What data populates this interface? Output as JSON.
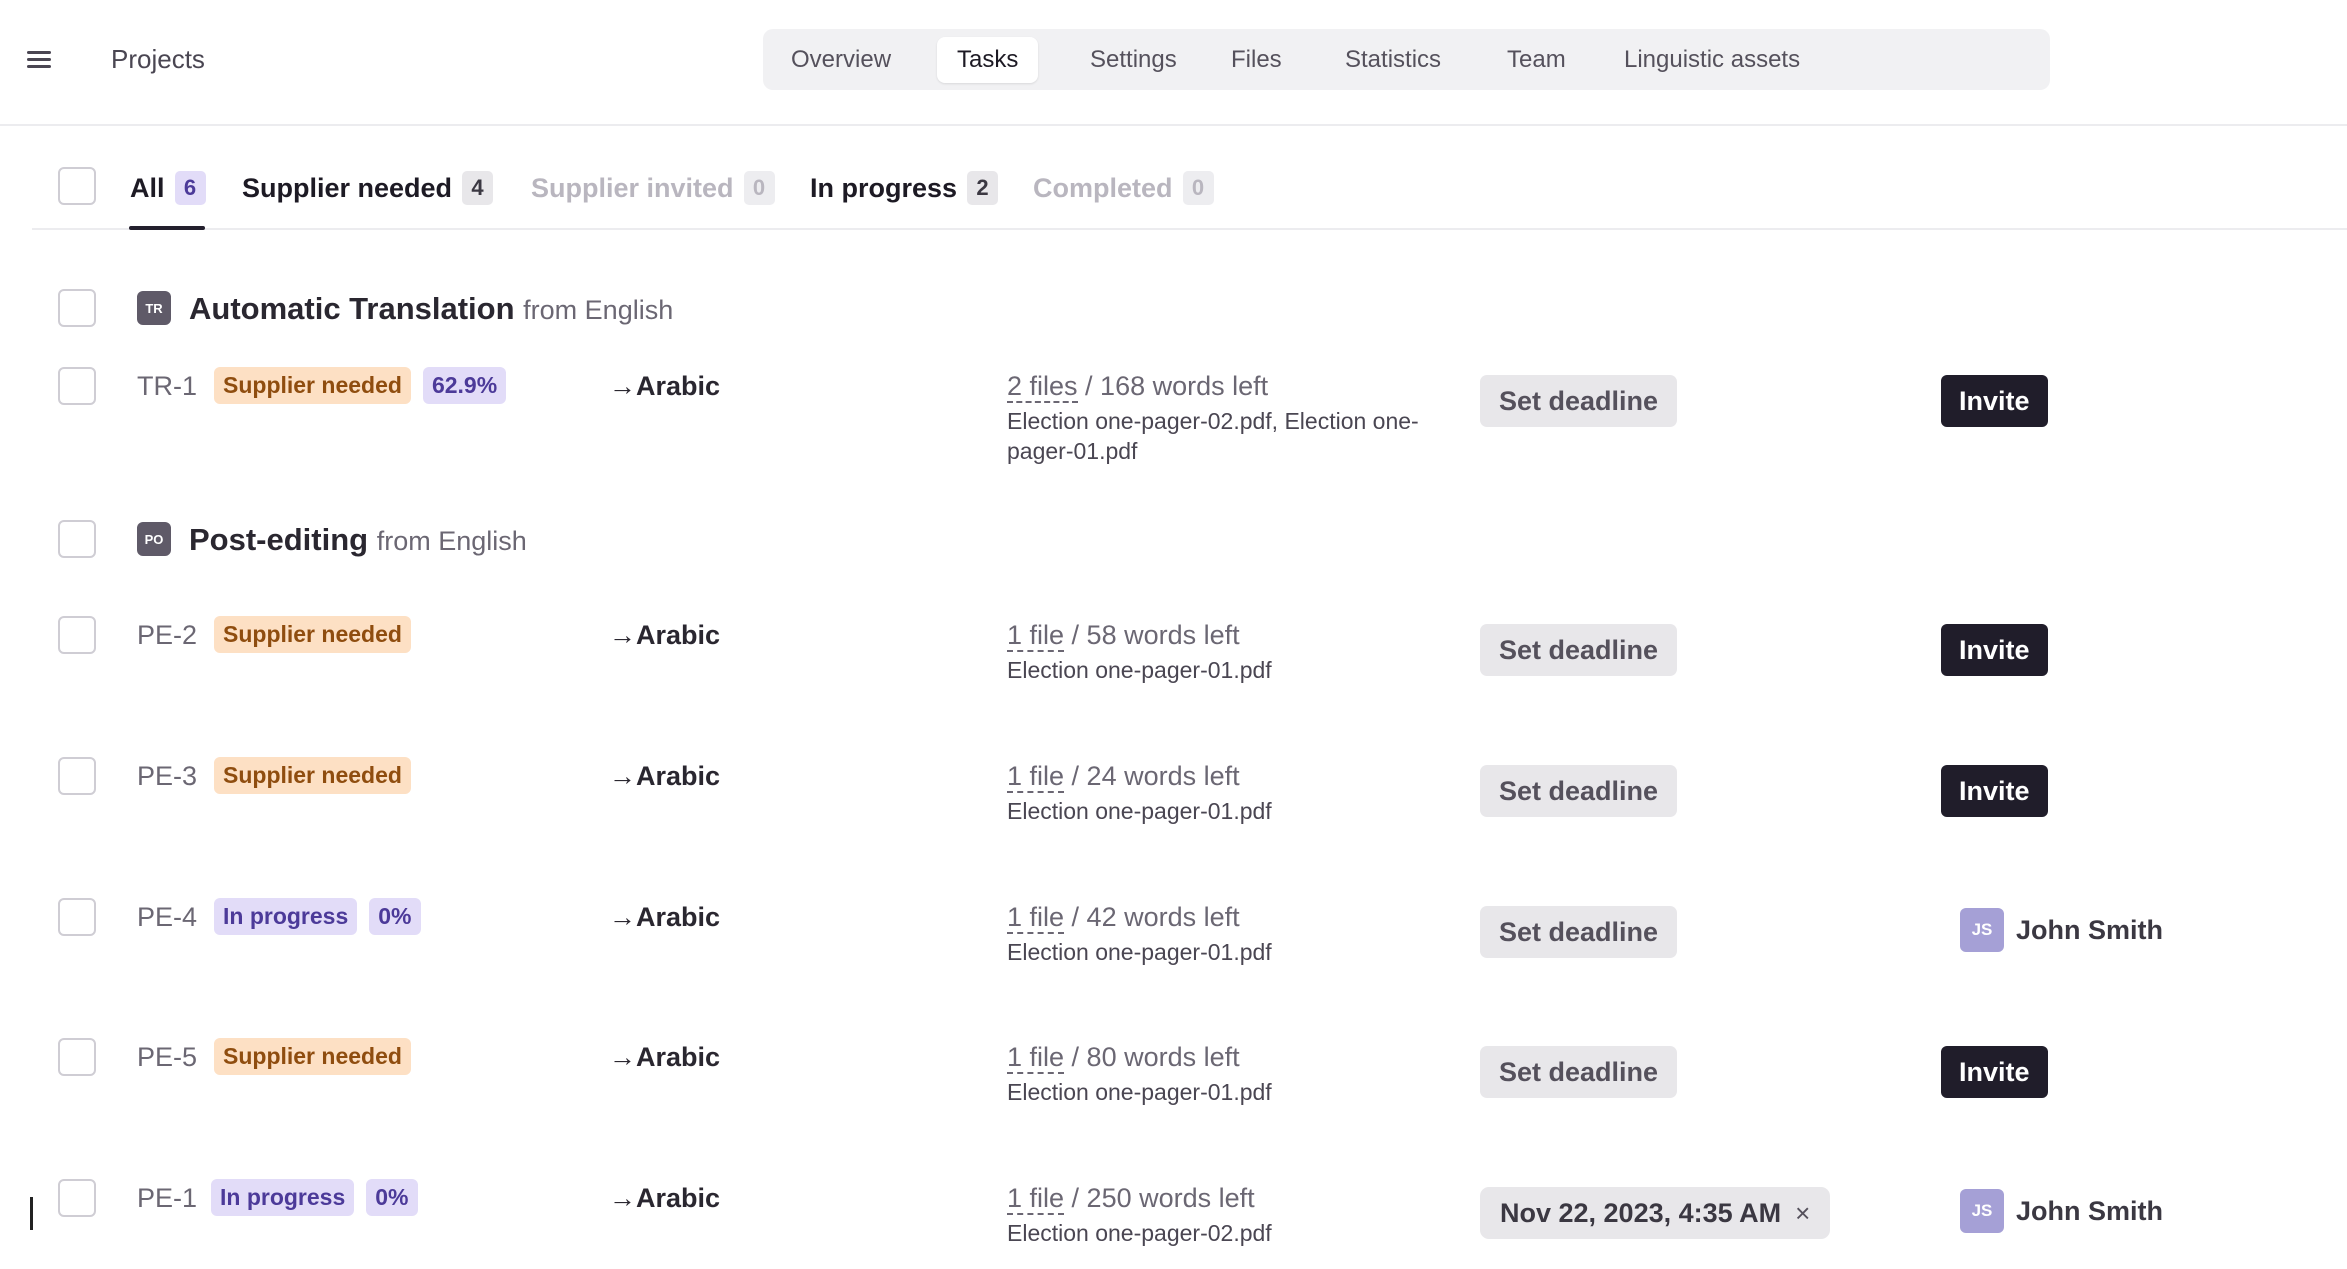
{
  "header": {
    "projects_label": "Projects",
    "tabs": [
      {
        "label": "Overview",
        "active": false
      },
      {
        "label": "Tasks",
        "active": true
      },
      {
        "label": "Settings",
        "active": false
      },
      {
        "label": "Files",
        "active": false
      },
      {
        "label": "Statistics",
        "active": false
      },
      {
        "label": "Team",
        "active": false
      },
      {
        "label": "Linguistic assets",
        "active": false
      }
    ]
  },
  "filters": [
    {
      "label": "All",
      "count": "6",
      "state": "active"
    },
    {
      "label": "Supplier needed",
      "count": "4",
      "state": "normal"
    },
    {
      "label": "Supplier invited",
      "count": "0",
      "state": "muted"
    },
    {
      "label": "In progress",
      "count": "2",
      "state": "normal"
    },
    {
      "label": "Completed",
      "count": "0",
      "state": "muted"
    }
  ],
  "groups": [
    {
      "icon": "TR",
      "title": "Automatic Translation",
      "from": "from English",
      "tasks": [
        {
          "id": "TR-1",
          "status": "Supplier needed",
          "percent": "62.9%",
          "target": "→Arabic",
          "files_link": "2 files",
          "words": " / 168 words left",
          "file_names": "Election one-pager-02.pdf, Election one-pager-01.pdf",
          "deadline_label": "Set deadline",
          "action": "Invite"
        }
      ]
    },
    {
      "icon": "PO",
      "title": "Post-editing",
      "from": "from English",
      "tasks": [
        {
          "id": "PE-2",
          "status": "Supplier needed",
          "target": "→Arabic",
          "files_link": "1 file",
          "words": " / 58 words left",
          "file_names": "Election one-pager-01.pdf",
          "deadline_label": "Set deadline",
          "action": "Invite"
        },
        {
          "id": "PE-3",
          "status": "Supplier needed",
          "target": "→Arabic",
          "files_link": "1 file",
          "words": " / 24 words left",
          "file_names": "Election one-pager-01.pdf",
          "deadline_label": "Set deadline",
          "action": "Invite"
        },
        {
          "id": "PE-4",
          "status": "In progress",
          "percent": "0%",
          "target": "→Arabic",
          "files_link": "1 file",
          "words": " / 42 words left",
          "file_names": "Election one-pager-01.pdf",
          "deadline_label": "Set deadline",
          "assignee_initials": "JS",
          "assignee_name": "John Smith"
        },
        {
          "id": "PE-5",
          "status": "Supplier needed",
          "target": "→Arabic",
          "files_link": "1 file",
          "words": " / 80 words left",
          "file_names": "Election one-pager-01.pdf",
          "deadline_label": "Set deadline",
          "action": "Invite"
        },
        {
          "id": "PE-1",
          "status": "In progress",
          "percent": "0%",
          "target": "→Arabic",
          "files_link": "1 file",
          "words": " / 250 words left",
          "file_names": "Election one-pager-02.pdf",
          "deadline_value": "Nov 22, 2023, 4:35 AM",
          "deadline_clear": "×",
          "assignee_initials": "JS",
          "assignee_name": "John Smith"
        }
      ]
    }
  ]
}
